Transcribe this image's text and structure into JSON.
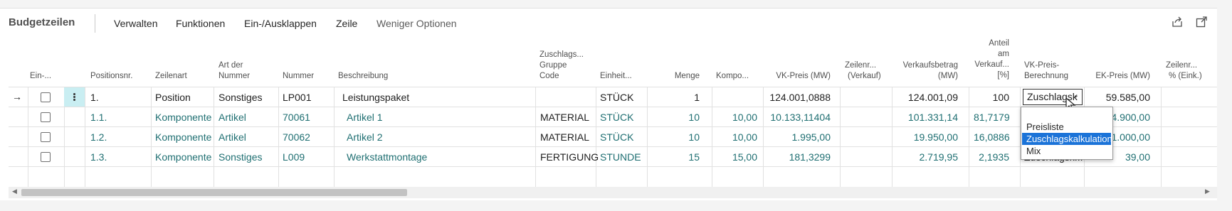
{
  "panel": {
    "title": "Budgetzeilen"
  },
  "toolbar": {
    "items": [
      "Verwalten",
      "Funktionen",
      "Ein-/Ausklappen",
      "Zeile",
      "Weniger Optionen"
    ],
    "share_icon": "share-icon",
    "expand_icon": "expand-icon"
  },
  "columns": {
    "ein": "Ein-...",
    "positionsnr": "Positionsnr.",
    "zeilenart": "Zeilenart",
    "art_der_nummer": [
      "Art der",
      "Nummer"
    ],
    "nummer": "Nummer",
    "beschreibung": "Beschreibung",
    "zuschlagsgruppe": [
      "Zuschlags...",
      "Gruppe",
      "Code"
    ],
    "einheit": "Einheit...",
    "menge": "Menge",
    "kompo": "Kompo...",
    "vk_preis": "VK-Preis (MW)",
    "zeilenrabatt_verkauf": [
      "Zeilenr...",
      "(Verkauf)"
    ],
    "verkaufsbetrag": [
      "Verkaufsbetrag",
      "(MW)"
    ],
    "anteil": [
      "Anteil",
      "am",
      "Verkauf...",
      "[%]"
    ],
    "vk_preis_berechnung": [
      "VK-Preis-",
      "Berechnung"
    ],
    "ek_preis": "EK-Preis (MW)",
    "zeilenrabatt_eink": [
      "Zeilenr...",
      "% (Eink.)"
    ]
  },
  "rows": [
    {
      "pos": "1.",
      "art": "Position",
      "art_nr": "Sonstiges",
      "nummer": "LP001",
      "beschr": "Leistungspaket",
      "gruppe": "",
      "einheit": "STÜCK",
      "menge": "1",
      "kompo": "",
      "vk": "124.001,0888",
      "betrag": "124.001,09",
      "anteil": "100",
      "berechnung": "Zuschlagsk",
      "ek": "59.585,00"
    },
    {
      "pos": "1.1.",
      "art": "Komponente",
      "art_nr": "Artikel",
      "nummer": "70061",
      "beschr": "Artikel 1",
      "gruppe": "MATERIAL",
      "einheit": "STÜCK",
      "menge": "10",
      "kompo": "10,00",
      "vk": "10.133,11404",
      "betrag": "101.331,14",
      "anteil": "81,7179",
      "berechnung": "",
      "ek": "4.900,00"
    },
    {
      "pos": "1.2.",
      "art": "Komponente",
      "art_nr": "Artikel",
      "nummer": "70062",
      "beschr": "Artikel 2",
      "gruppe": "MATERIAL",
      "einheit": "STÜCK",
      "menge": "10",
      "kompo": "10,00",
      "vk": "1.995,00",
      "betrag": "19.950,00",
      "anteil": "16,0886",
      "berechnung": "",
      "ek": "1.000,00"
    },
    {
      "pos": "1.3.",
      "art": "Komponente",
      "art_nr": "Sonstiges",
      "nummer": "L009",
      "beschr": "Werkstattmontage",
      "gruppe": "FERTIGUNG",
      "einheit": "STUNDE",
      "menge": "15",
      "kompo": "15,00",
      "vk": "181,3299",
      "betrag": "2.719,95",
      "anteil": "2,1935",
      "berechnung": "Zuschlagsk...",
      "ek": "39,00"
    }
  ],
  "dropdown": {
    "options": [
      "Preisliste",
      "Zuschlagskalkulation",
      "Mix"
    ],
    "selected": "Zuschlagskalkulation"
  },
  "row_marker": "→"
}
